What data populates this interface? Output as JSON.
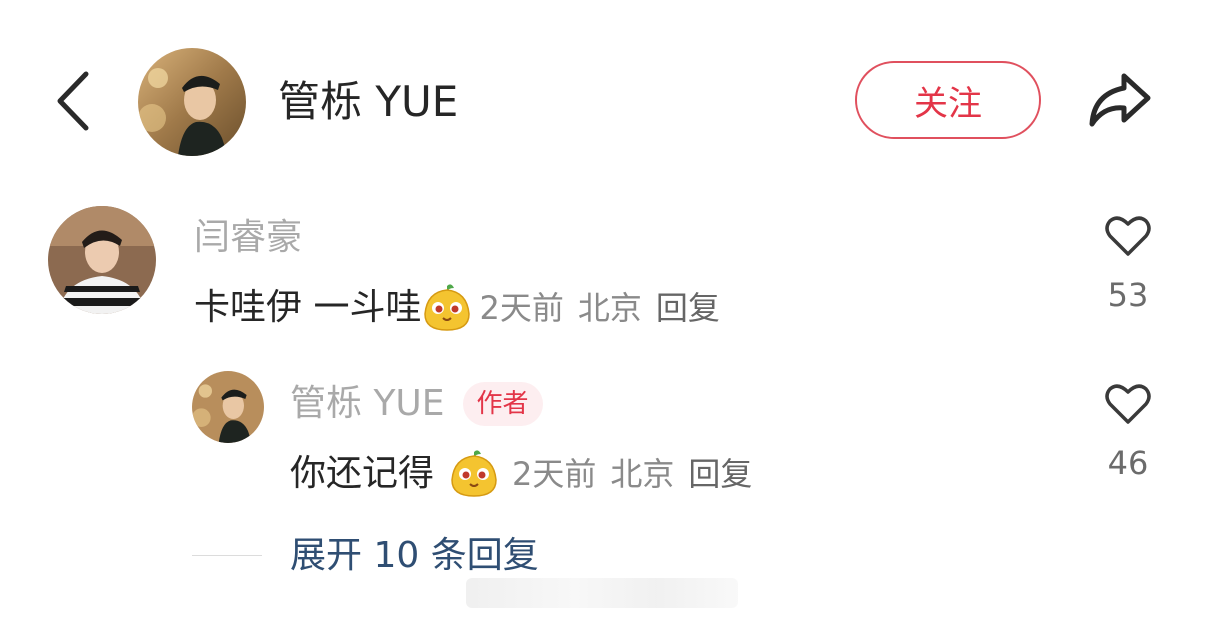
{
  "header": {
    "author_name": "管栎 YUE",
    "follow_label": "关注",
    "back_icon": "chevron-left-icon",
    "share_icon": "share-arrow-icon"
  },
  "comment": {
    "user_name": "闫睿豪",
    "text": "卡哇伊 一斗哇",
    "sticker_icon": "yellow-blob-sticker",
    "time": "2天前",
    "location": "北京",
    "reply_label": "回复",
    "like_count": "53"
  },
  "reply": {
    "user_name": "管栎 YUE",
    "author_tag": "作者",
    "text": "你还记得",
    "sticker_icon": "yellow-blob-sticker",
    "time": "2天前",
    "location": "北京",
    "reply_label": "回复",
    "like_count": "46"
  },
  "expand": {
    "label": "展开 10 条回复"
  },
  "colors": {
    "accent_red": "#e33548",
    "link_blue": "#2f4e73",
    "muted_gray": "#a9a9a9"
  }
}
